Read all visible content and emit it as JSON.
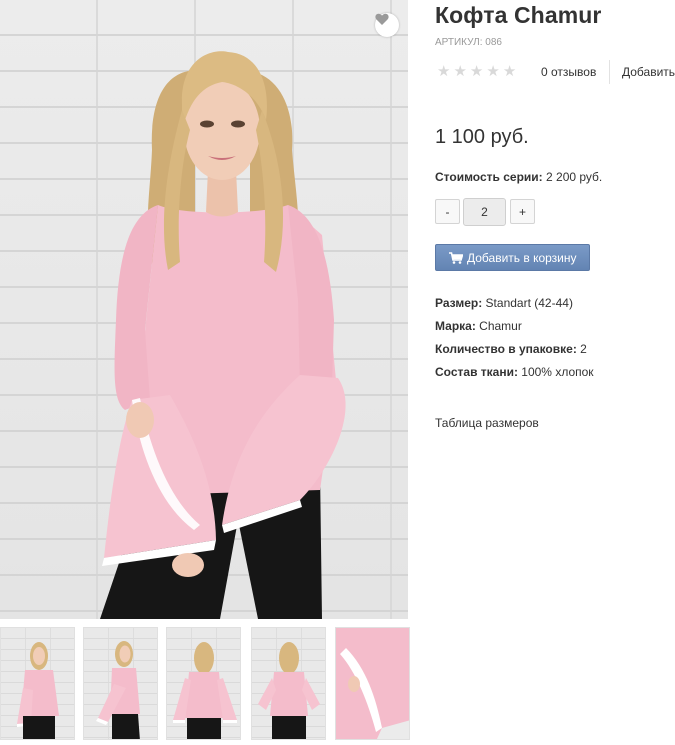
{
  "product": {
    "title": "Кофта Chamur",
    "sku": "АРТИКУЛ: 086",
    "price": "1 100 руб.",
    "rating_value": 0,
    "rating_max": 5
  },
  "reviews": {
    "count_label": "0 отзывов",
    "add_label": "Добавить"
  },
  "series": {
    "label": "Стоимость серии:",
    "value": " 2 200 руб."
  },
  "quantity": {
    "minus": "-",
    "value": "2",
    "plus": "+"
  },
  "cart": {
    "label": "Добавить в корзину",
    "icon": "cart-icon"
  },
  "favorite": {
    "icon": "heart-icon"
  },
  "specs": [
    {
      "label": "Размер:",
      "value": " Standart (42-44)"
    },
    {
      "label": "Марка:",
      "value": " Chamur"
    },
    {
      "label": "Количество в упаковке:",
      "value": " 2"
    },
    {
      "label": "Состав ткани:",
      "value": " 100% хлопок"
    }
  ],
  "size_table_link": "Таблица размеров",
  "colors": {
    "accent_button": "#6e8fbe",
    "sweater_pink": "#f4bccb",
    "hair_blonde": "#d8b77f",
    "pants_black": "#161616",
    "star_empty": "#d9d9d9"
  },
  "thumbnails": [
    {
      "icon": "product-photo-front"
    },
    {
      "icon": "product-photo-side"
    },
    {
      "icon": "product-photo-back"
    },
    {
      "icon": "product-photo-back-arms"
    },
    {
      "icon": "product-photo-sleeve-detail"
    }
  ]
}
